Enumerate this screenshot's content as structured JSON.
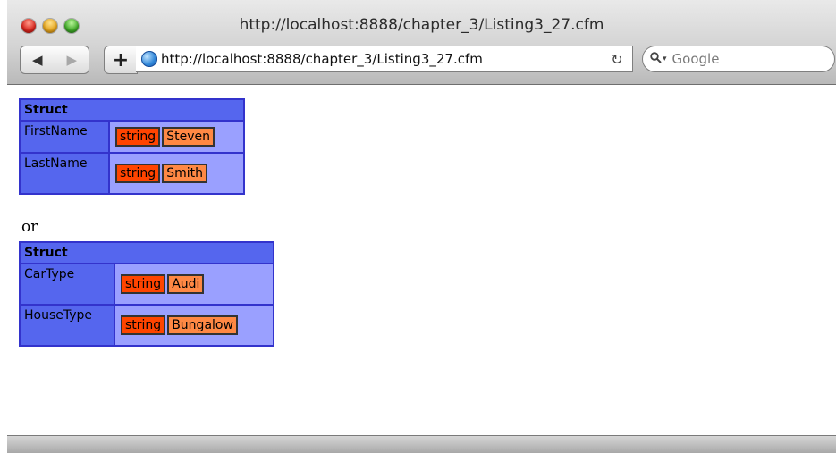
{
  "window": {
    "title": "http://localhost:8888/chapter_3/Listing3_27.cfm"
  },
  "toolbar": {
    "back_icon": "◀",
    "forward_icon": "▶",
    "add_label": "+",
    "url": "http://localhost:8888/chapter_3/Listing3_27.cfm",
    "reload_icon": "↻",
    "search_placeholder": "Google"
  },
  "dumps": [
    {
      "header": "Struct",
      "rows": [
        {
          "key": "FirstName",
          "type": "string",
          "value": "Steven"
        },
        {
          "key": "LastName",
          "type": "string",
          "value": "Smith"
        }
      ]
    },
    {
      "header": "Struct",
      "rows": [
        {
          "key": "CarType",
          "type": "string",
          "value": "Audi"
        },
        {
          "key": "HouseType",
          "type": "string",
          "value": "Bungalow"
        }
      ]
    }
  ],
  "separator_text": "or",
  "colors": {
    "struct_header": "#5566ee",
    "value_bg": "#9aa0ff",
    "type_pill": "#ff4400",
    "value_pill": "#ff8844"
  }
}
